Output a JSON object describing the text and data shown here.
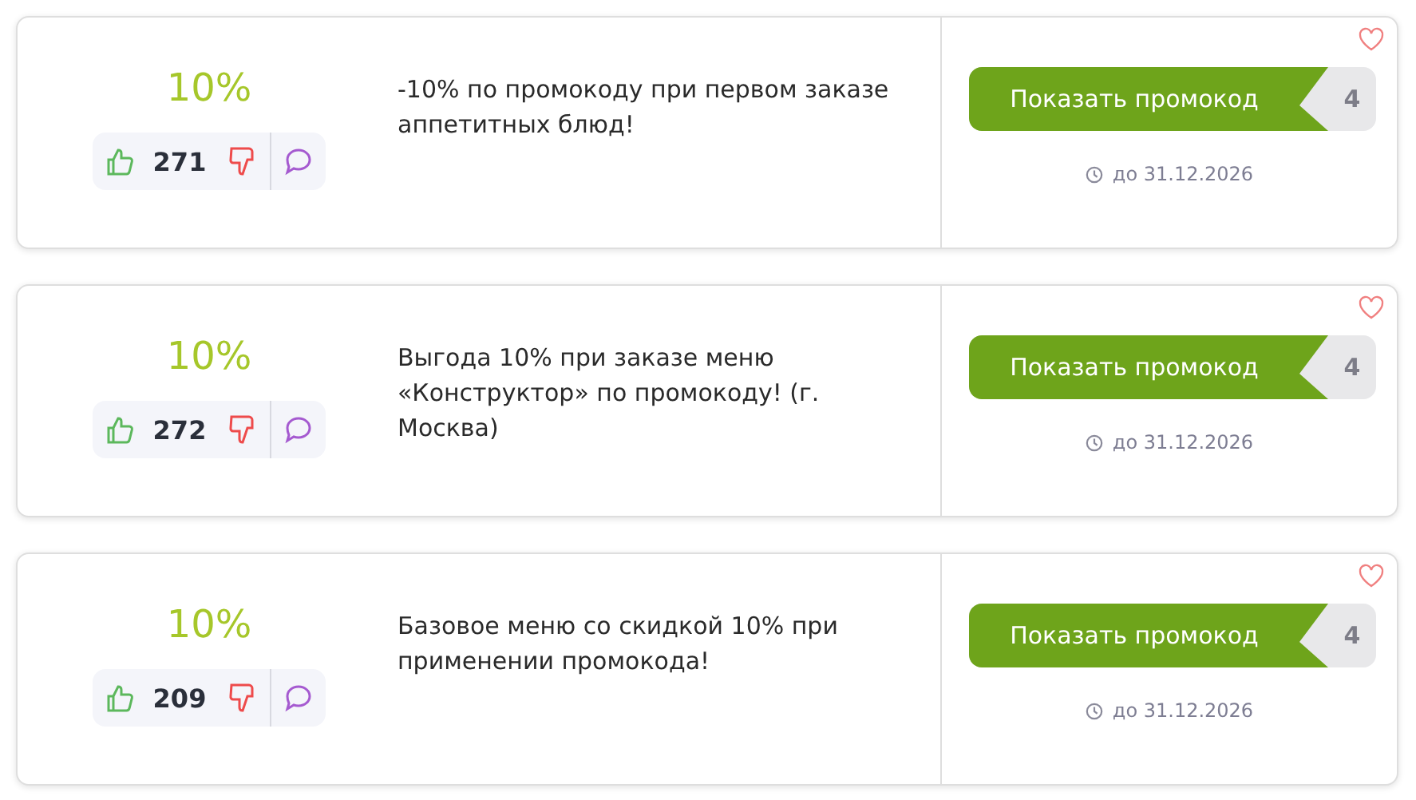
{
  "coupons": [
    {
      "discount": "10%",
      "likes": "271",
      "description": "-10% по промокоду при первом заказе аппетитных блюд!",
      "button": "Показать промокод",
      "code_hint": "4",
      "expires": "до 31.12.2026"
    },
    {
      "discount": "10%",
      "likes": "272",
      "description": "Выгода 10% при заказе меню «Конструктор» по промокоду! (г. Москва)",
      "button": "Показать промокод",
      "code_hint": "4",
      "expires": "до 31.12.2026"
    },
    {
      "discount": "10%",
      "likes": "209",
      "description": "Базовое меню со скидкой 10% при применении промокода!",
      "button": "Показать промокод",
      "code_hint": "4",
      "expires": "до 31.12.2026"
    }
  ]
}
